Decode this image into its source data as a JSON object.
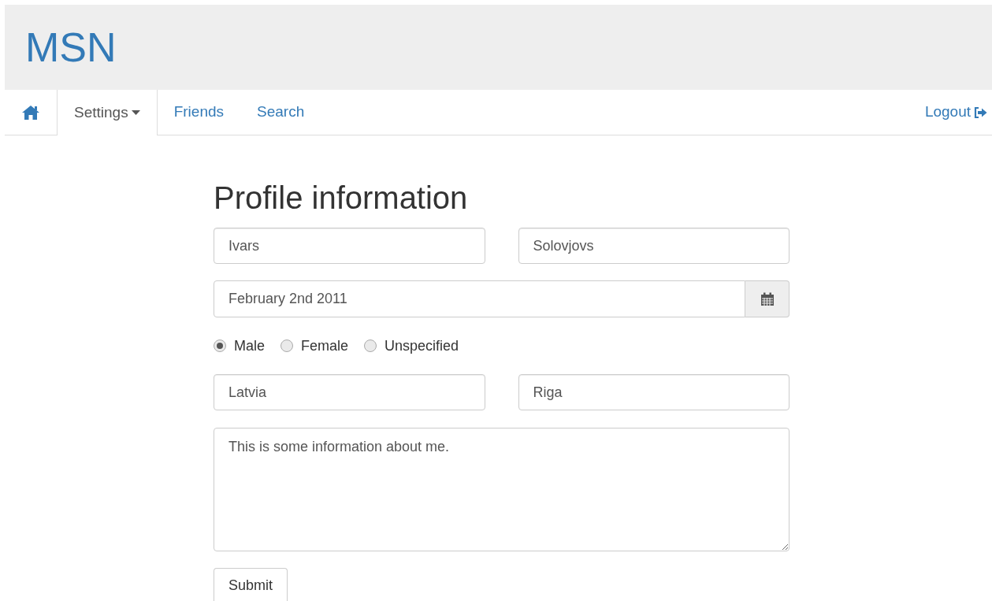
{
  "brand": "MSN",
  "nav": [
    {
      "kind": "home",
      "selected": false
    },
    {
      "kind": "dropdown",
      "label": "Settings",
      "selected": true
    },
    {
      "kind": "link",
      "label": "Friends",
      "selected": false
    },
    {
      "kind": "link",
      "label": "Search",
      "selected": false
    }
  ],
  "logout": "Logout",
  "form": {
    "title": "Profile information",
    "first_name": "Ivars",
    "last_name": "Solovjovs",
    "birth_date": "February 2nd 2011",
    "gender": [
      {
        "label": "Male",
        "selected": true
      },
      {
        "label": "Female",
        "selected": false
      },
      {
        "label": "Unspecified",
        "selected": false
      }
    ],
    "country": "Latvia",
    "city": "Riga",
    "about": "This is some information about me.",
    "submit": "Submit"
  }
}
